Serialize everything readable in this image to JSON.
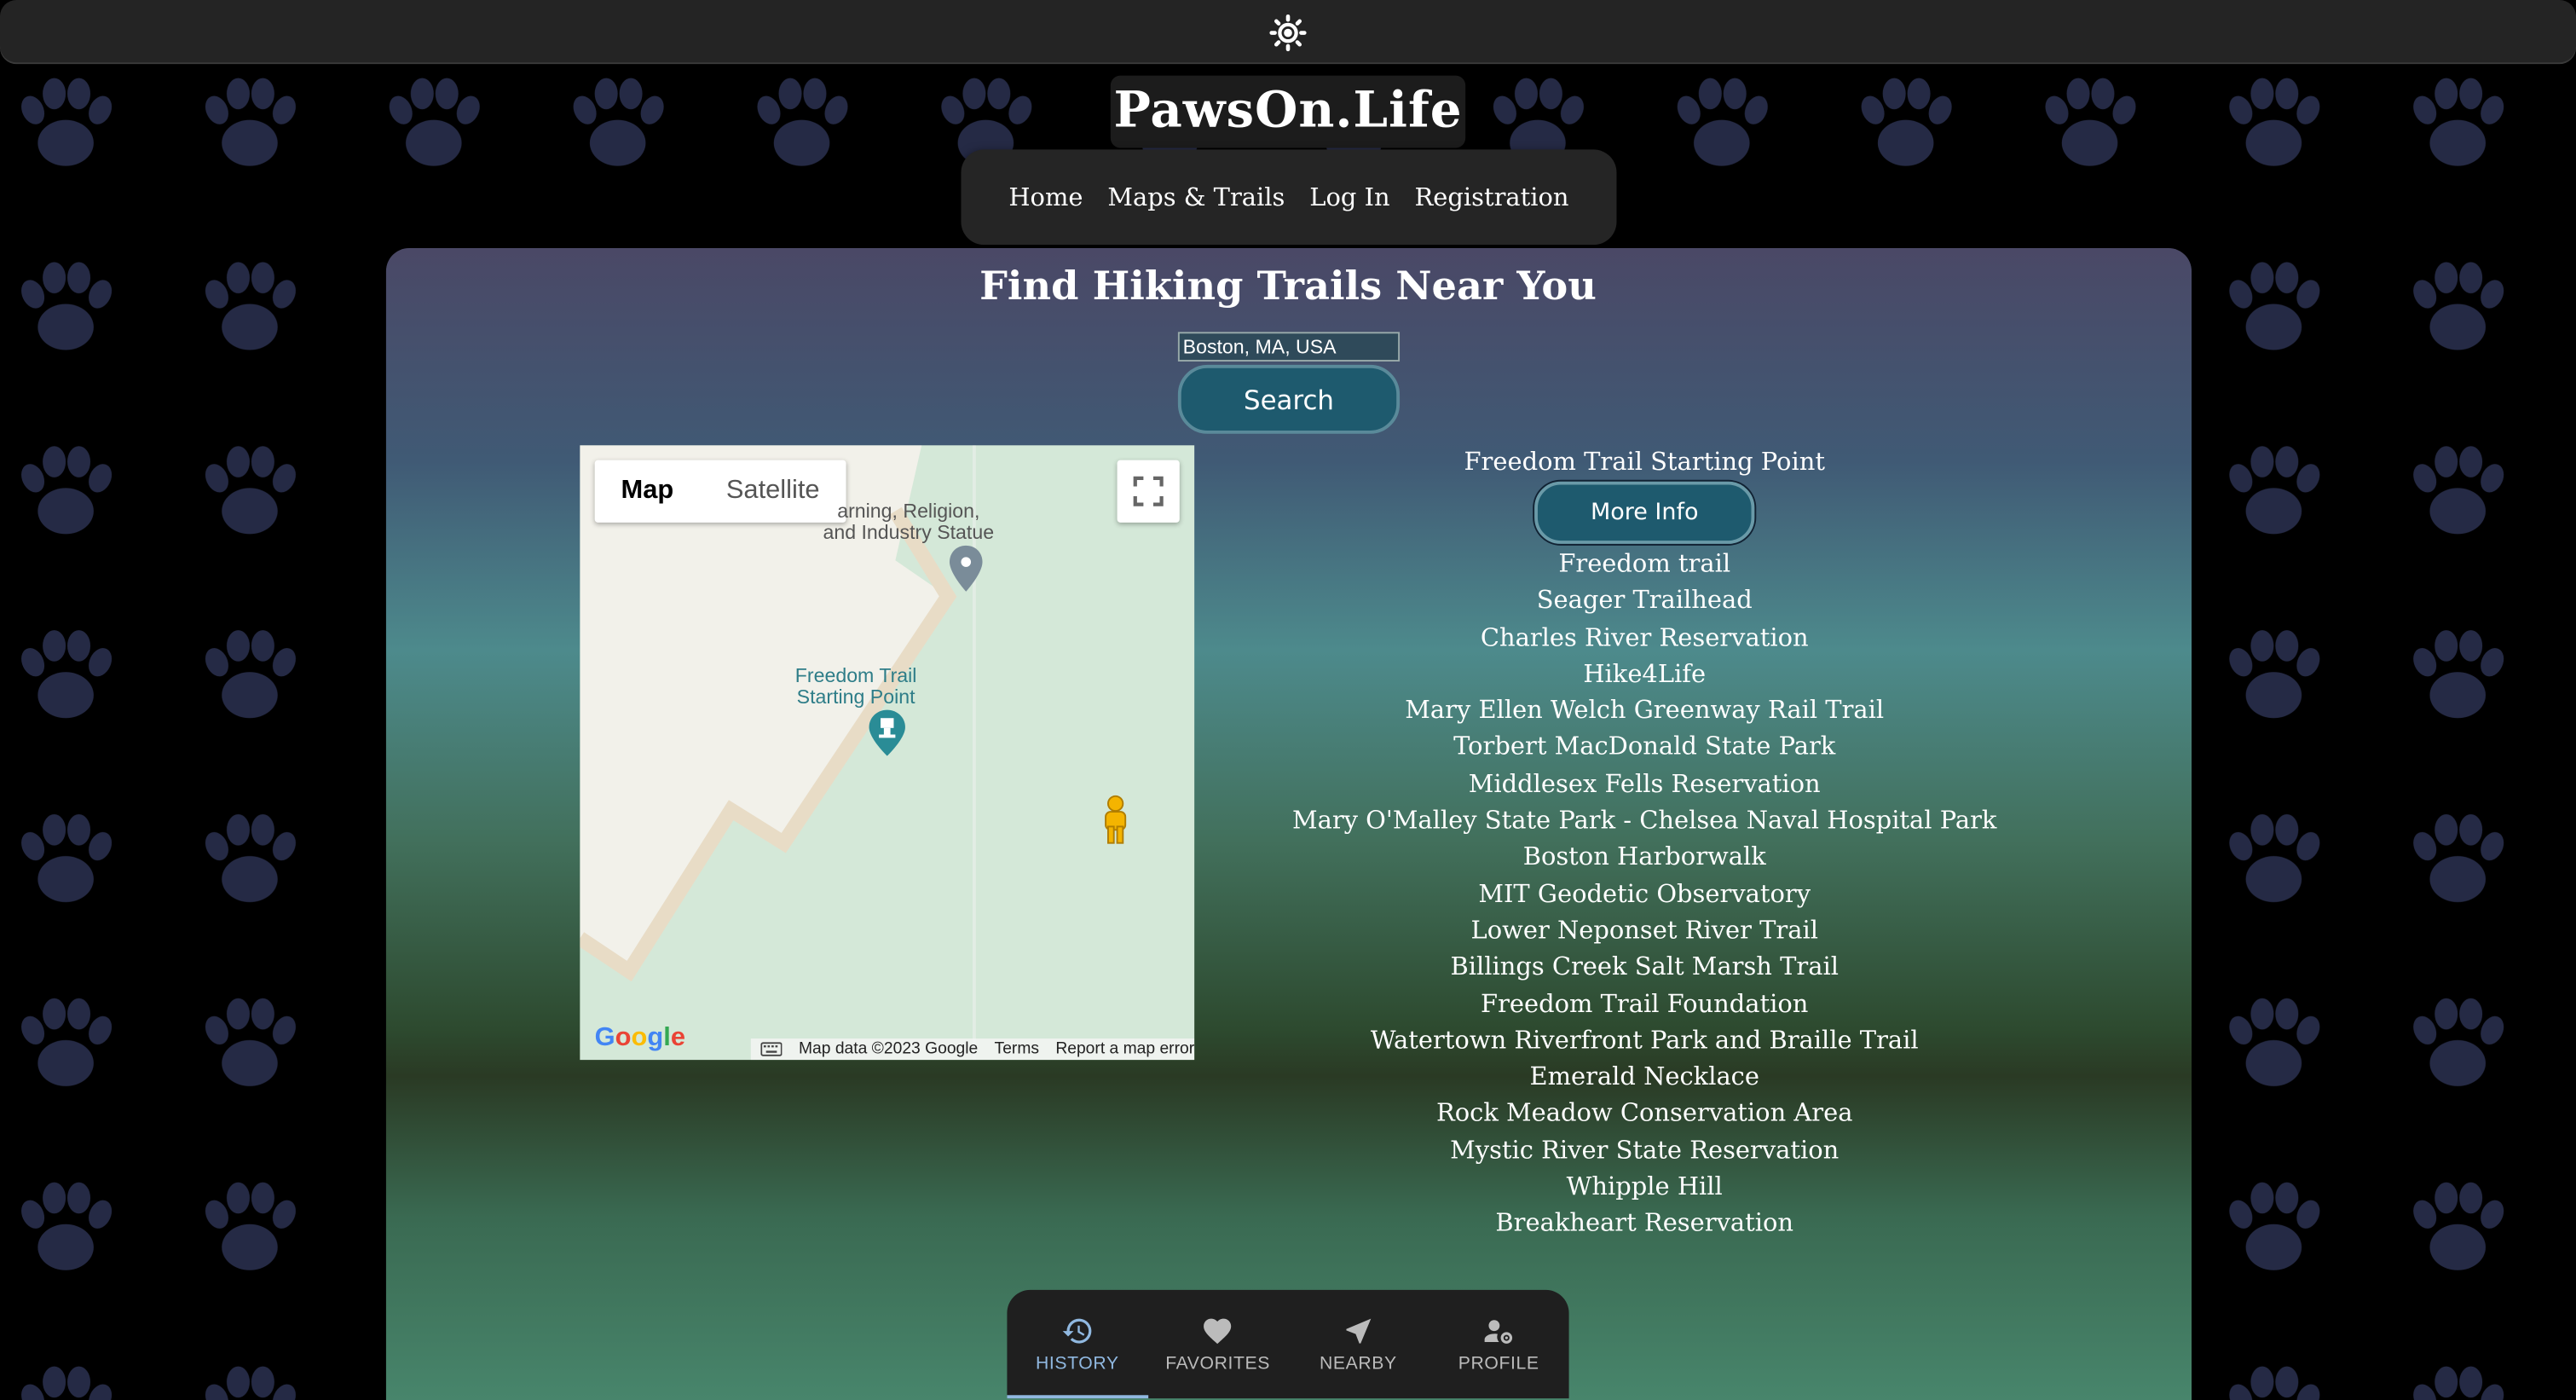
{
  "site": {
    "logo": "PawsOn.Life"
  },
  "nav": {
    "items": [
      {
        "label": "Home"
      },
      {
        "label": "Maps & Trails"
      },
      {
        "label": "Log In"
      },
      {
        "label": "Registration"
      }
    ]
  },
  "main": {
    "title": "Find Hiking Trails Near You",
    "search": {
      "value": "Boston, MA, USA",
      "button_label": "Search"
    }
  },
  "map": {
    "tabs": [
      {
        "label": "Map",
        "active": true
      },
      {
        "label": "Satellite",
        "active": false
      }
    ],
    "labels": {
      "statue": "...arning, Religion,\nand Industry Statue",
      "statue_line1": "arning, Religion,",
      "statue_line2": "and Industry Statue",
      "freedom_line1": "Freedom Trail",
      "freedom_line2": "Starting Point"
    },
    "google_logo": "Google",
    "footer": {
      "data": "Map data ©2023 Google",
      "terms": "Terms",
      "report": "Report a map error"
    },
    "colors": {
      "park": "#d4e8d8",
      "land": "#f2f1ea",
      "road": "#e8dcc6"
    }
  },
  "trails": {
    "first": "Freedom Trail Starting Point",
    "more_info_label": "More Info",
    "items": [
      "Freedom trail",
      "Seager Trailhead",
      "Charles River Reservation",
      "Hike4Life",
      "Mary Ellen Welch Greenway Rail Trail",
      "Torbert MacDonald State Park",
      "Middlesex Fells Reservation",
      "Mary O'Malley State Park - Chelsea Naval Hospital Park",
      "Boston Harborwalk",
      "MIT Geodetic Observatory",
      "Lower Neponset River Trail",
      "Billings Creek Salt Marsh Trail",
      "Freedom Trail Foundation",
      "Watertown Riverfront Park and Braille Trail",
      "Emerald Necklace",
      "Rock Meadow Conservation Area",
      "Mystic River State Reservation",
      "Whipple Hill",
      "Breakheart Reservation"
    ]
  },
  "bottom_nav": {
    "items": [
      {
        "label": "HISTORY",
        "icon": "history-icon",
        "active": true
      },
      {
        "label": "FAVORITES",
        "icon": "heart-icon",
        "active": false
      },
      {
        "label": "NEARBY",
        "icon": "navigation-arrow-icon",
        "active": false
      },
      {
        "label": "PROFILE",
        "icon": "person-settings-icon",
        "active": false
      }
    ]
  },
  "colors": {
    "background": "#000000",
    "paw": "#252a45",
    "button": "#1e5a6e",
    "active_tab": "#90b8e0"
  }
}
